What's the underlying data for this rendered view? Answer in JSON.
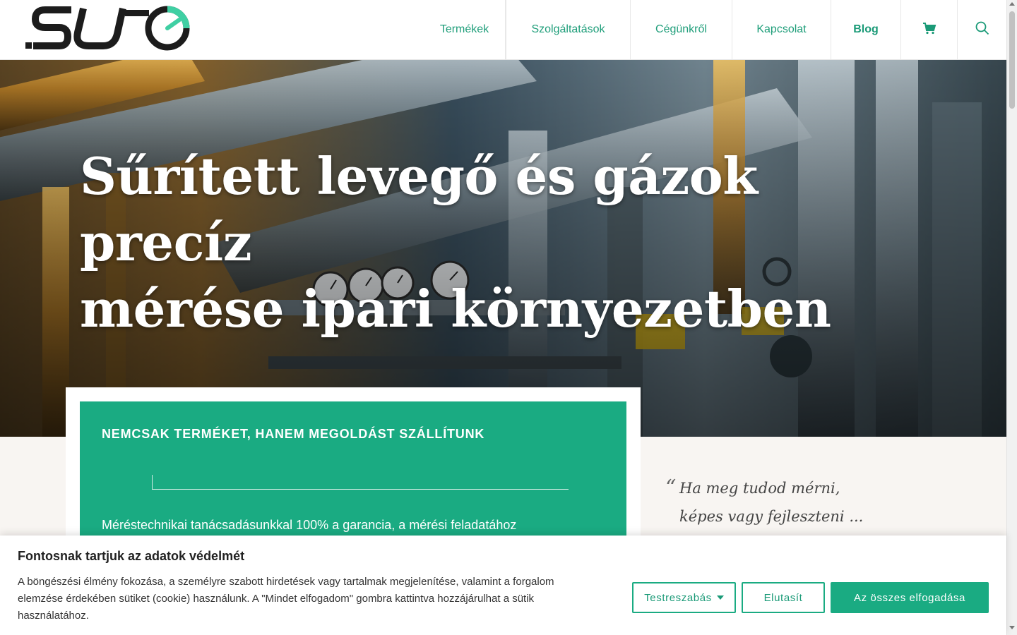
{
  "header": {
    "logo_text": ".SUTO",
    "nav": [
      {
        "label": "Termékek"
      },
      {
        "label": "Szolgáltatások"
      },
      {
        "label": "Cégünkről"
      },
      {
        "label": "Kapcsolat"
      },
      {
        "label": "Blog"
      }
    ],
    "cart_icon": "cart-icon",
    "search_icon": "search-icon"
  },
  "hero": {
    "title_line1": "Sűrített levegő és gázok precíz",
    "title_line2": "mérése ipari környezetben"
  },
  "feature": {
    "heading": "NEMCSAK TERMÉKET, HANEM MEGOLDÁST SZÁLLÍTUNK",
    "text": "Méréstechnikai tanácsadásunkkal 100% a garancia, a mérési feladatához"
  },
  "quote": {
    "mark": "“",
    "line1": "Ha meg tudod mérni,",
    "line2": "képes vagy fejleszteni ..."
  },
  "cookie": {
    "title": "Fontosnak tartjuk az adatok védelmét",
    "text": "A böngészési élmény fokozása, a személyre szabott hirdetések vagy tartalmak megjelenítése, valamint a forgalom elemzése érdekében sütiket (cookie) használunk. A \"Mindet elfogadom\" gombra kattintva hozzájárulhat a sütik használatához.",
    "customize_label": "Testreszabás",
    "reject_label": "Elutasít",
    "accept_label": "Az összes elfogadása"
  },
  "colors": {
    "brand_green": "#1aab82",
    "nav_text": "#1f9e7a"
  }
}
